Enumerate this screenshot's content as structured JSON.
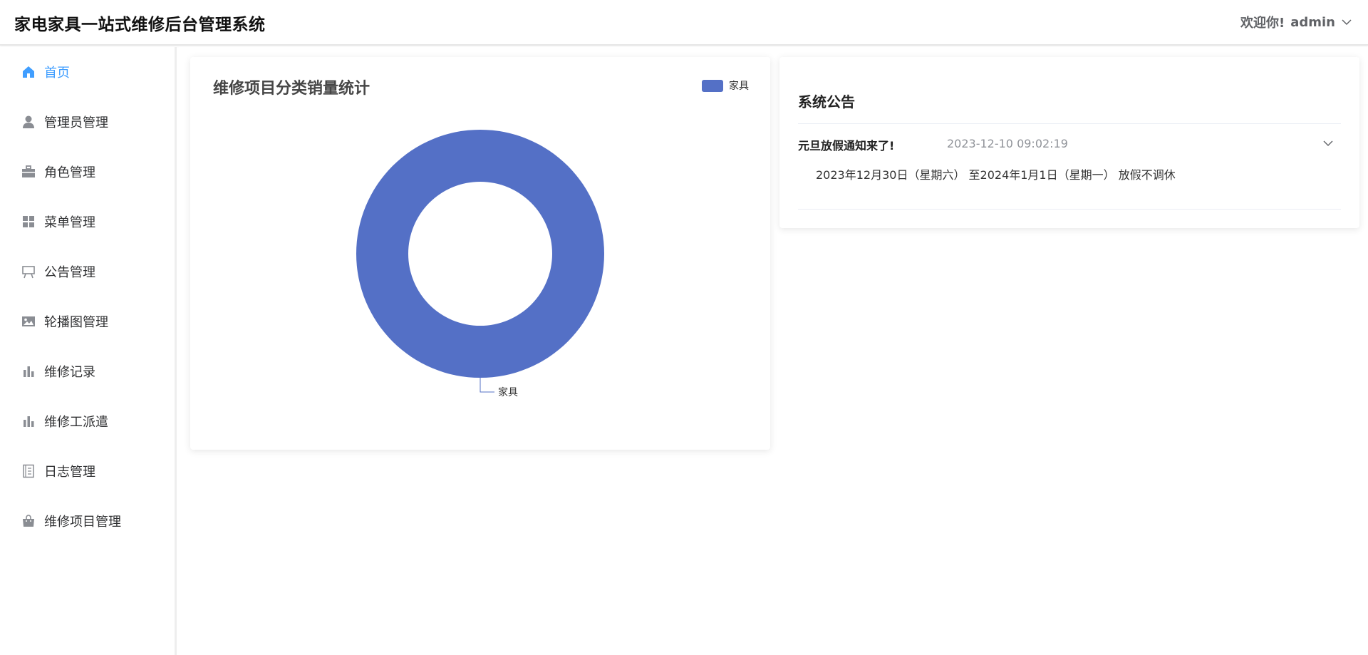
{
  "header": {
    "title": "家电家具一站式维修后台管理系统",
    "welcome": "欢迎你!",
    "username": "admin"
  },
  "sidebar": {
    "items": [
      {
        "label": "首页",
        "icon": "home-icon",
        "active": true
      },
      {
        "label": "管理员管理",
        "icon": "user-icon"
      },
      {
        "label": "角色管理",
        "icon": "briefcase-icon"
      },
      {
        "label": "菜单管理",
        "icon": "grid-icon"
      },
      {
        "label": "公告管理",
        "icon": "easel-icon"
      },
      {
        "label": "轮播图管理",
        "icon": "picture-icon"
      },
      {
        "label": "维修记录",
        "icon": "bar-chart-icon"
      },
      {
        "label": "维修工派遣",
        "icon": "bar-chart-icon"
      },
      {
        "label": "日志管理",
        "icon": "document-icon"
      },
      {
        "label": "维修项目管理",
        "icon": "shopping-bag-icon"
      }
    ],
    "active_color": "#409EFF"
  },
  "chart_card": {
    "title": "维修项目分类销量统计"
  },
  "chart_data": {
    "type": "pie",
    "title": "维修项目分类销量统计",
    "categories": [
      "家具"
    ],
    "values": [
      1
    ],
    "series": [
      {
        "name": "家具",
        "color": "#5470C6"
      }
    ],
    "legend": "top-right",
    "donut": true
  },
  "notice_card": {
    "title": "系统公告",
    "items": [
      {
        "headline": "元旦放假通知来了!",
        "time": "2023-12-10 09:02:19",
        "content": "2023年12月30日（星期六） 至2024年1月1日（星期一） 放假不调休"
      }
    ]
  }
}
